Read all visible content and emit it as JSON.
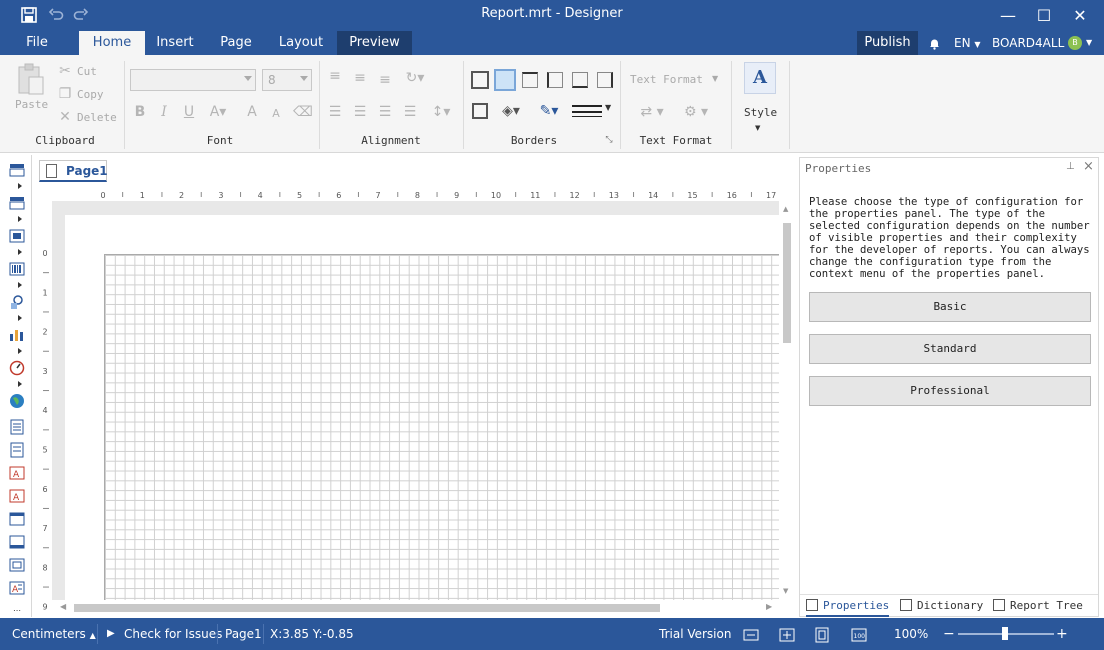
{
  "window": {
    "title": "Report.mrt - Designer",
    "minimize": "—",
    "maximize": "☐",
    "close": "✕"
  },
  "tabs": {
    "file": "File",
    "home": "Home",
    "insert": "Insert",
    "page": "Page",
    "layout": "Layout",
    "preview": "Preview"
  },
  "account": {
    "publish": "Publish",
    "language": "EN",
    "user": "BOARD4ALL",
    "avatar_initial": "B"
  },
  "ribbon": {
    "clipboard": {
      "label": "Clipboard",
      "paste": "Paste",
      "cut": "Cut",
      "copy": "Copy",
      "delete": "Delete"
    },
    "font": {
      "label": "Font",
      "font_size": "8"
    },
    "alignment": {
      "label": "Alignment"
    },
    "borders": {
      "label": "Borders"
    },
    "text_format": {
      "label": "Text Format",
      "combo": "Text Format"
    },
    "style": {
      "label": "Style"
    }
  },
  "document": {
    "tab": "Page1",
    "ruler_h": [
      "0",
      "1",
      "2",
      "3",
      "4",
      "5",
      "6",
      "7",
      "8",
      "9",
      "10",
      "11",
      "12",
      "13",
      "14",
      "15",
      "16",
      "17"
    ],
    "ruler_v": [
      "0",
      "1",
      "2",
      "3",
      "4",
      "5",
      "6",
      "7",
      "8",
      "9"
    ]
  },
  "properties": {
    "title": "Properties",
    "description": "Please choose the type of configuration for the properties panel. The type of the selected configuration depends on the number of visible properties and their complexity for the developer of reports. You can always change the configuration type from the context menu of the properties panel.",
    "buttons": [
      "Basic",
      "Standard",
      "Professional"
    ],
    "tabs": [
      "Properties",
      "Dictionary",
      "Report Tree"
    ]
  },
  "status": {
    "units": "Centimeters",
    "check": "Check for Issues",
    "page": "Page1",
    "coords": "X:3.85 Y:-0.85",
    "trial": "Trial Version",
    "zoom": "100%",
    "zoom_level": 0.5
  },
  "colors": {
    "brand": "#2b579a",
    "ribbon": "#f5f5f5"
  }
}
